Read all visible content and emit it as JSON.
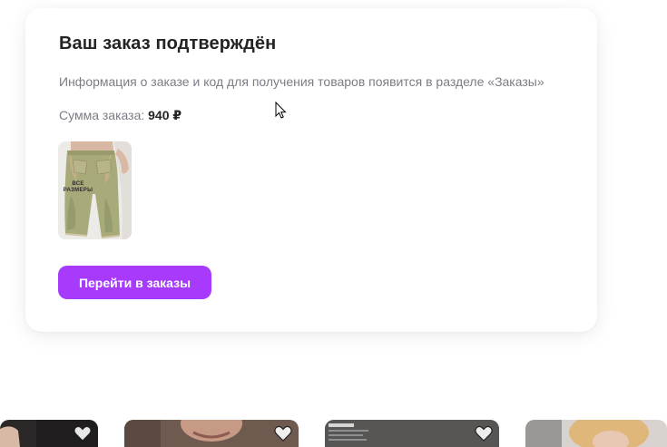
{
  "order": {
    "title": "Ваш заказ подтверждён",
    "info": "Информация о заказе и код для получения товаров появится в разделе «Заказы»",
    "sum_label": "Сумма заказа:",
    "sum_value": "940 ₽",
    "product_image": {
      "icon": "shorts-product-image",
      "overlay_text": "ВСЕ РАЗМЕРЫ"
    },
    "button_label": "Перейти в заказы"
  },
  "recommendations": {
    "items": [
      {
        "icon": "product-photo",
        "favorite_icon": "heart-icon"
      },
      {
        "icon": "product-photo",
        "favorite_icon": "heart-icon"
      },
      {
        "icon": "product-photo",
        "favorite_icon": "heart-icon"
      },
      {
        "icon": "product-photo",
        "favorite_icon": "heart-icon"
      }
    ]
  },
  "colors": {
    "accent": "#a73afd",
    "title_text": "#242424",
    "secondary_text": "#7c7c86"
  }
}
